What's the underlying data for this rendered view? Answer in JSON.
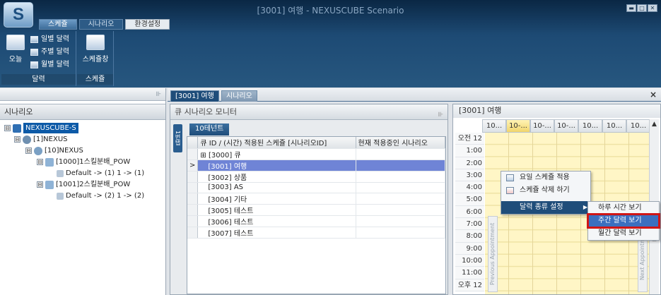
{
  "window": {
    "title": "[3001] 여행 - NEXUSCUBE Scenario",
    "app_letter": "S",
    "controls": [
      "▬",
      "□",
      "✕"
    ]
  },
  "ribbon": {
    "tabs": [
      {
        "label": "스케쥴"
      },
      {
        "label": "시나리오"
      },
      {
        "label": "환경설정"
      }
    ],
    "calendar_group": {
      "label": "달력",
      "today": "오늘",
      "daily": "일별 달력",
      "weekly": "주별 달력",
      "monthly": "월별 달력"
    },
    "schedule_group": {
      "label": "스케쥴",
      "schedule_register": "스케쥴창"
    }
  },
  "left_panel": {
    "pin": "⊪",
    "header": "시나리오",
    "tree": [
      {
        "label": "NEXUSCUBE-S",
        "expander": "⊟"
      },
      {
        "label": "[1]NEXUS",
        "expander": "⊟"
      },
      {
        "label": "[10]NEXUS",
        "expander": "⊟"
      },
      {
        "label": "[1000]1스킬분배_POW",
        "expander": "⊟"
      },
      {
        "label": "Default -> (1)  1 -> (1)",
        "expander": ""
      },
      {
        "label": "[1001]2스킬분배_POW",
        "expander": "⊟"
      },
      {
        "label": "Default -> (2)  1 -> (2)",
        "expander": ""
      }
    ]
  },
  "doc_tabs": {
    "tabs": [
      {
        "label": "[3001] 여행"
      },
      {
        "label": "시나리오"
      }
    ],
    "close": "×"
  },
  "monitor": {
    "title": "큐 시나리오 모니터",
    "pin": "⊪",
    "vertical_tab": "1번탭",
    "tab": "10테넌트",
    "columns": [
      "큐 ID / (시간) 적용된 스케쥴 [시나리오ID]",
      "현재 적용중인 시나리오"
    ],
    "rows": [
      {
        "marker": "",
        "label": "[3000] 큐",
        "current": ""
      },
      {
        "marker": ">",
        "label": "[3001] 여행",
        "current": ""
      },
      {
        "marker": "",
        "label": "[3002] 상품",
        "current": ""
      },
      {
        "marker": "",
        "label": "[3003] AS",
        "current": ""
      },
      {
        "marker": "",
        "label": "[3004] 기타",
        "current": ""
      },
      {
        "marker": "",
        "label": "[3005] 테스트",
        "current": ""
      },
      {
        "marker": "",
        "label": "[3006] 테스트",
        "current": ""
      },
      {
        "marker": "",
        "label": "[3007] 테스트",
        "current": ""
      }
    ],
    "expander": "⊞"
  },
  "calendar": {
    "title": "[3001] 여행",
    "columns": [
      "10...",
      "10-...",
      "10-...",
      "10-...",
      "10...",
      "10...",
      "10..."
    ],
    "hours": [
      "오전 12",
      "1:00",
      "2:00",
      "3:00",
      "4:00",
      "5:00",
      "6:00",
      "7:00",
      "8:00",
      "9:00",
      "10:00",
      "11:00",
      "오후 12"
    ],
    "prev_nav": "Previous Appointment",
    "next_nav": "Next Appointment",
    "scroll_up": "▲",
    "scroll_mid": "≡"
  },
  "context_menu": {
    "items": [
      {
        "label": "요일 스케쥴 적용"
      },
      {
        "label": "스케쥴 삭제 하기"
      },
      {
        "label": "달력 종류 설정",
        "arrow": "▶"
      }
    ]
  },
  "submenu": {
    "items": [
      {
        "label": "하루 시간 보기"
      },
      {
        "label": "주간 달력 보기"
      },
      {
        "label": "월간 달력 보기"
      }
    ]
  },
  "colors": {
    "accent": "#1f4d7a",
    "highlight_border": "#d01515",
    "calendar_bg": "#fff6c6"
  }
}
